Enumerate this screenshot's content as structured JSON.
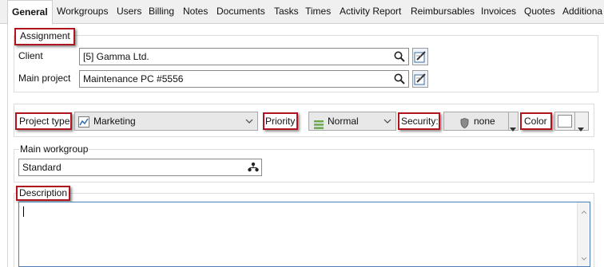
{
  "tabs": [
    {
      "label": "General",
      "active": true
    },
    {
      "label": "Workgroups"
    },
    {
      "label": "Users"
    },
    {
      "label": "Billing"
    },
    {
      "label": "Notes"
    },
    {
      "label": "Documents"
    },
    {
      "label": "Tasks"
    },
    {
      "label": "Times"
    },
    {
      "label": "Activity Report"
    },
    {
      "label": "Reimbursables"
    },
    {
      "label": "Invoices"
    },
    {
      "label": "Quotes"
    },
    {
      "label": "Additiona"
    }
  ],
  "assignment": {
    "title": "Assignment",
    "client_label": "Client",
    "client_value": "[5] Gamma Ltd.",
    "project_label": "Main project",
    "project_value": "Maintenance PC #5556"
  },
  "classification": {
    "project_type_label": "Project type",
    "project_type_value": "Marketing",
    "priority_label": "Priority",
    "priority_value": "Normal",
    "security_label": "Security:",
    "security_value": "none",
    "color_label": "Color"
  },
  "workgroup": {
    "title": "Main workgroup",
    "value": "Standard"
  },
  "description": {
    "title": "Description",
    "value": ""
  },
  "colors": {
    "highlight": "#b0141c",
    "accent": "#4a7fb7",
    "priority_icon": "#6aa84f"
  }
}
